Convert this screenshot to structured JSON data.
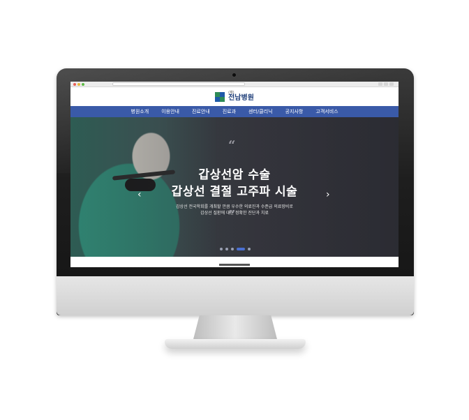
{
  "site": {
    "logo_sub": "(재)",
    "logo_name": "전남병원"
  },
  "nav": {
    "items": [
      {
        "label": "병원소개"
      },
      {
        "label": "이용안내"
      },
      {
        "label": "진료안내"
      },
      {
        "label": "진료과"
      },
      {
        "label": "센터/클리닉"
      },
      {
        "label": "공지사항"
      },
      {
        "label": "고객서비스"
      }
    ]
  },
  "hero": {
    "quote_open": "“",
    "quote_close": "”",
    "headline_1": "갑상선암 수술",
    "headline_2": "갑상선 결절 고주파 시술",
    "desc_1": "갑상선 전국학회를 개최할 만큼 우수한 의료진과 수준급 의료장비로",
    "desc_2": "갑상선 질환에 대한 정확한 진단과 치료",
    "prev_arrow": "‹",
    "next_arrow": "›",
    "pager_count": 5,
    "pager_active": 4
  },
  "colors": {
    "nav_bg": "#3a5aa8",
    "logo_text": "#1f3f7a",
    "pager_active": "#4a6fd0"
  }
}
